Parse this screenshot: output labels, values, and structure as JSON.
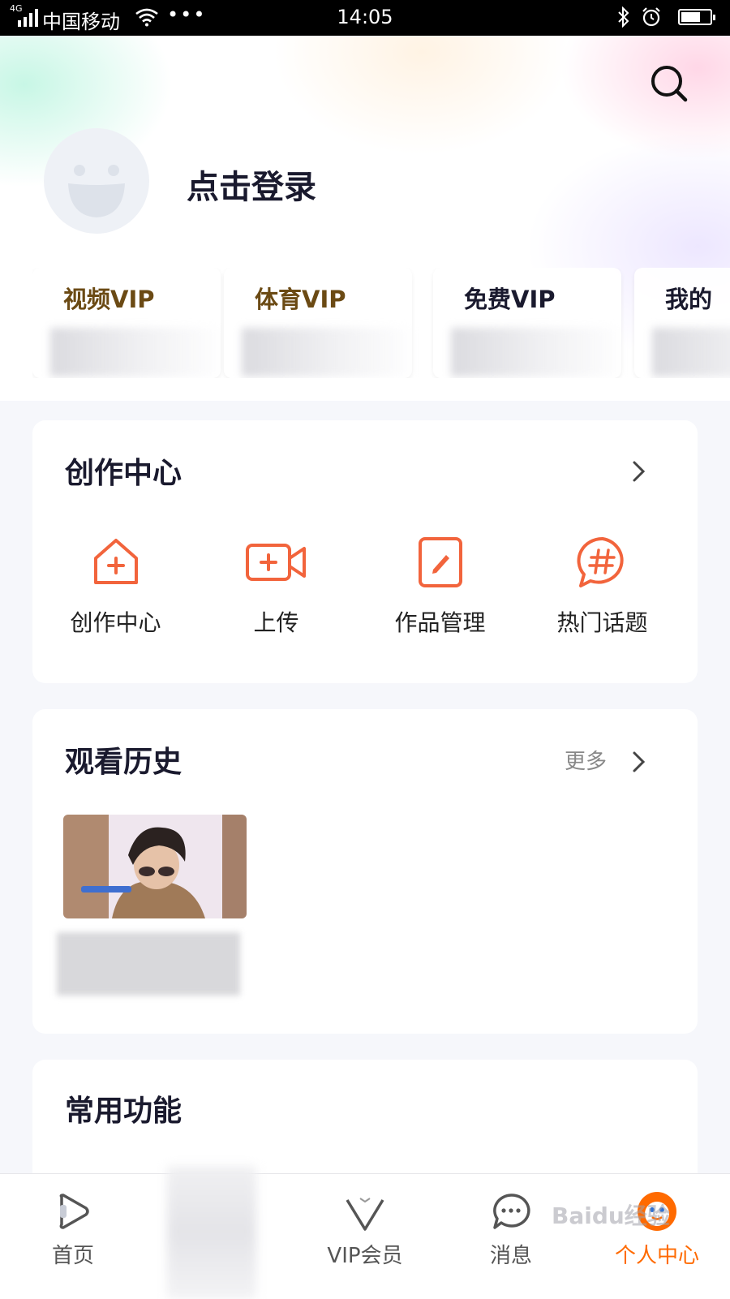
{
  "status_bar": {
    "network": "4G",
    "carrier": "中国移动",
    "time": "14:05",
    "battery_level": 0.6
  },
  "header": {
    "search_icon": "search-icon",
    "login_text": "点击登录"
  },
  "vip_cards": [
    {
      "label": "视频VIP",
      "style": "gold"
    },
    {
      "label": "体育VIP",
      "style": "gold"
    },
    {
      "label": "免费VIP",
      "style": "dark"
    },
    {
      "label": "我的",
      "style": "dark"
    }
  ],
  "creation": {
    "title": "创作中心",
    "tools": [
      {
        "label": "创作中心",
        "icon": "house-plus-icon"
      },
      {
        "label": "上传",
        "icon": "video-plus-icon"
      },
      {
        "label": "作品管理",
        "icon": "pencil-icon"
      },
      {
        "label": "热门话题",
        "icon": "hashtag-bubble-icon"
      }
    ]
  },
  "history": {
    "title": "观看历史",
    "more_label": "更多"
  },
  "common": {
    "title": "常用功能"
  },
  "tabbar": {
    "items": [
      {
        "label": "首页",
        "icon": "play-icon"
      },
      {
        "label": "VIP会员",
        "icon": "vip-v-icon"
      },
      {
        "label": "消息",
        "icon": "chat-bubble-icon"
      },
      {
        "label": "个人中心",
        "icon": "mascot-avatar-icon"
      }
    ],
    "active_color": "#ff6a00",
    "watermark": "Baidu经验"
  },
  "colors": {
    "accent_orange": "#f2643c",
    "gold_text": "#6b4a14"
  }
}
